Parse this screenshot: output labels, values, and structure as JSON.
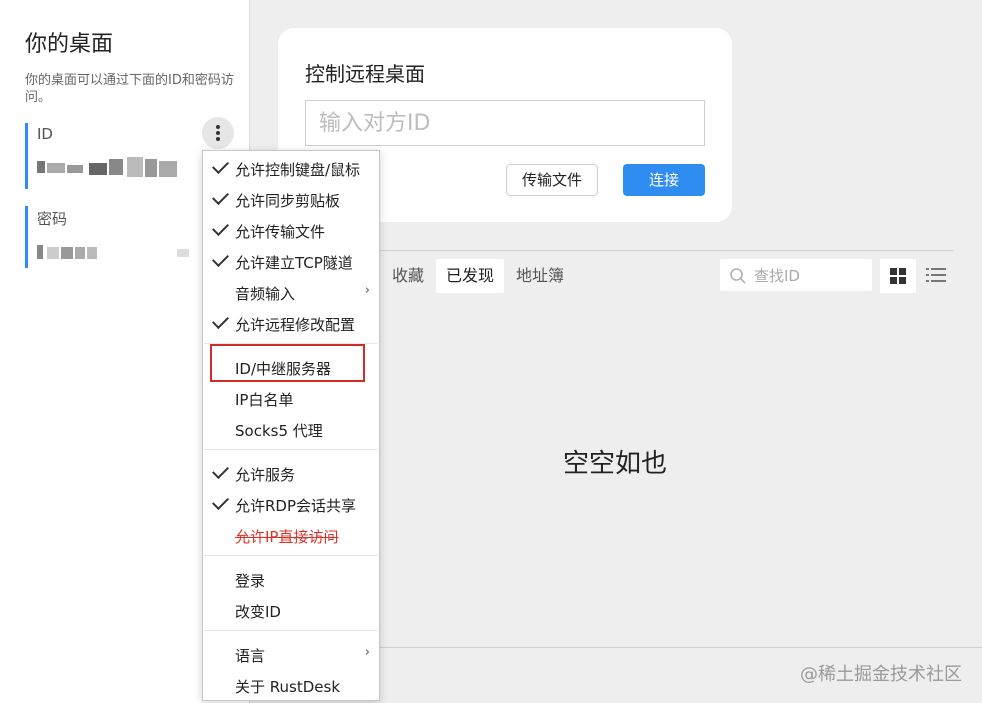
{
  "left_panel": {
    "title": "你的桌面",
    "description": "你的桌面可以通过下面的ID和密码访问。",
    "id_label": "ID",
    "password_label": "密码"
  },
  "remote_card": {
    "title": "控制远程桌面",
    "input_placeholder": "输入对方ID",
    "transfer_button": "传输文件",
    "connect_button": "连接",
    "accent_color": "#2f8cf0"
  },
  "tabs": [
    "收藏",
    "已发现",
    "地址簿"
  ],
  "active_tab": "已发现",
  "search": {
    "placeholder": "查找ID",
    "icon": "search-icon"
  },
  "view_toggle": {
    "grid_icon": "grid-view-icon",
    "list_icon": "list-view-icon",
    "active": "grid"
  },
  "empty_message": "空空如也",
  "watermark": "@稀土掘金技术社区",
  "menu": {
    "groups": [
      [
        {
          "label": "允许控制键盘/鼠标",
          "checked": true
        },
        {
          "label": "允许同步剪贴板",
          "checked": true
        },
        {
          "label": "允许传输文件",
          "checked": true
        },
        {
          "label": "允许建立TCP隧道",
          "checked": true
        },
        {
          "label": "音频输入",
          "checked": false,
          "submenu": true
        },
        {
          "label": "允许远程修改配置",
          "checked": true
        }
      ],
      [
        {
          "label": "ID/中继服务器",
          "checked": false,
          "highlighted": true
        },
        {
          "label": "IP白名单",
          "checked": false
        },
        {
          "label": "Socks5 代理",
          "checked": false
        }
      ],
      [
        {
          "label": "允许服务",
          "checked": true
        },
        {
          "label": "允许RDP会话共享",
          "checked": true
        },
        {
          "label": "允许IP直接访问",
          "checked": false,
          "disabled": true
        }
      ],
      [
        {
          "label": "登录",
          "checked": false
        },
        {
          "label": "改变ID",
          "checked": false
        }
      ],
      [
        {
          "label": "语言",
          "checked": false,
          "submenu": true
        },
        {
          "label": "关于 RustDesk",
          "checked": false
        }
      ]
    ],
    "highlight_color": "#d32a2a",
    "disabled_color": "#d9342b"
  }
}
